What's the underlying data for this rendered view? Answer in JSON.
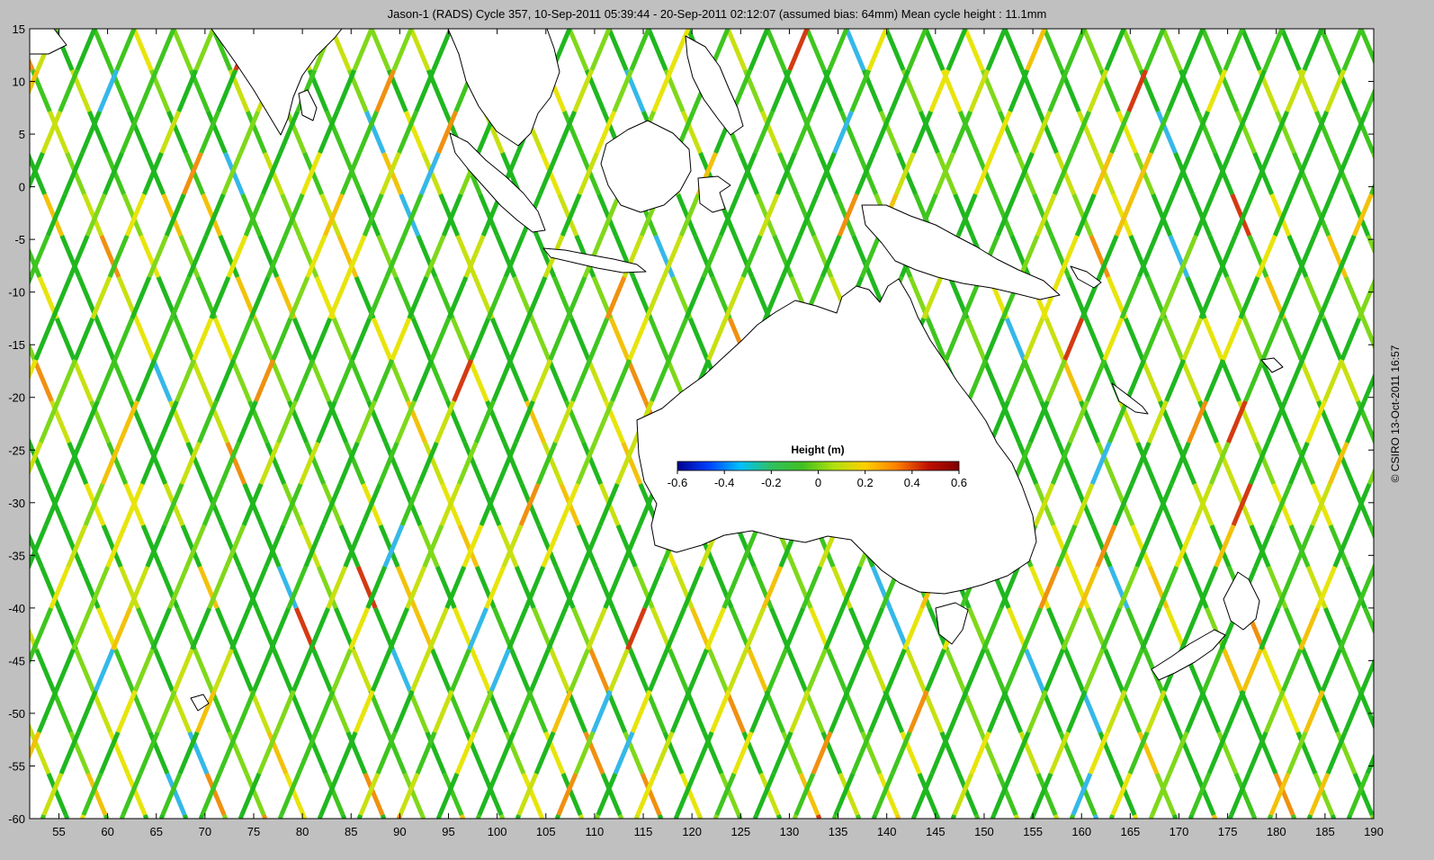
{
  "title": "Jason-1 (RADS) Cycle 357, 10-Sep-2011 05:39:44 - 20-Sep-2011 02:12:07 (assumed bias: 64mm)  Mean cycle height : 11.1mm",
  "credit": "© CSIRO 13-Oct-2011 16:57",
  "map": {
    "lon_range": [
      52,
      190
    ],
    "lat_range": [
      -60,
      15
    ],
    "x_ticks": [
      "55",
      "60",
      "65",
      "70",
      "75",
      "80",
      "85",
      "90",
      "95",
      "100",
      "105",
      "110",
      "115",
      "120",
      "125",
      "130",
      "135",
      "140",
      "145",
      "150",
      "155",
      "160",
      "165",
      "170",
      "175",
      "180",
      "185",
      "190"
    ],
    "y_ticks": [
      "15",
      "10",
      "5",
      "0",
      "-5",
      "-10",
      "-15",
      "-20",
      "-25",
      "-30",
      "-35",
      "-40",
      "-45",
      "-50",
      "-55",
      "-60"
    ],
    "track_colors": [
      "#1fb71f",
      "#3ec51f",
      "#7fd81a",
      "#c8e010",
      "#e8e40a",
      "#f2c20a",
      "#f09010",
      "#35b8e8",
      "#d43a12"
    ]
  },
  "colorbar": {
    "label": "Height (m)",
    "ticks": [
      "-0.6",
      "-0.4",
      "-0.2",
      "0",
      "0.2",
      "0.4",
      "0.6"
    ],
    "colors": [
      "#00008f",
      "#0040ff",
      "#00c0ff",
      "#30c060",
      "#40c020",
      "#b0e010",
      "#ffd000",
      "#ff8000",
      "#c01000",
      "#800000"
    ]
  },
  "chart_data": {
    "type": "heatmap",
    "title": "Jason-1 (RADS) Cycle 357, 10-Sep-2011 05:39:44 - 20-Sep-2011 02:12:07 (assumed bias: 64mm)  Mean cycle height : 11.1mm",
    "xlim": [
      52,
      190
    ],
    "ylim": [
      -60,
      15
    ],
    "colorbar_label": "Height (m)",
    "clim": [
      -0.6,
      0.6
    ],
    "legend_position": "center over Australia"
  }
}
